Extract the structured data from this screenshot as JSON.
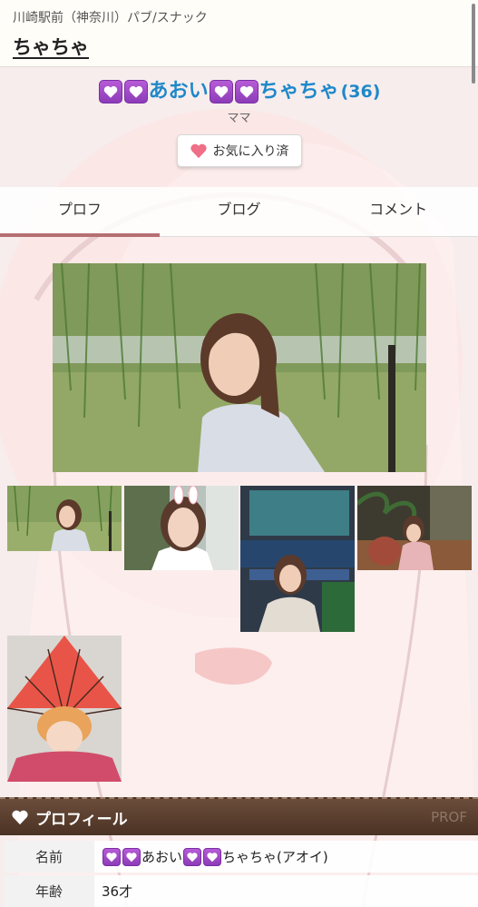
{
  "header": {
    "location": "川崎駅前（神奈川）パブ/スナック",
    "shop_name": "ちゃちゃ"
  },
  "cast": {
    "name_part1": "あおい",
    "name_part2": "ちゃちゃ",
    "age": "(36)",
    "role": "ママ"
  },
  "favorite": {
    "label": "お気に入り済"
  },
  "tabs": [
    {
      "label": "プロフ",
      "active": true
    },
    {
      "label": "ブログ",
      "active": false
    },
    {
      "label": "コメント",
      "active": false
    }
  ],
  "profile_section": {
    "title": "プロフィール",
    "title_en": "PROF"
  },
  "profile": [
    {
      "key": "名前",
      "value_part1": "あおい",
      "value_part2": "ちゃちゃ(アオイ)"
    },
    {
      "key": "年齢",
      "value": "36才"
    }
  ],
  "colors": {
    "accent": "#b56f72",
    "name_blue": "#1f88c9",
    "heart_purple": "#9a45c4",
    "bar_brown": "#5a3e2e"
  }
}
